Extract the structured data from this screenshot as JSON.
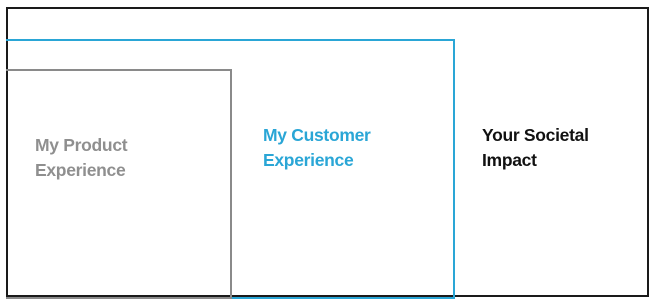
{
  "diagram": {
    "colors": {
      "outer": "#1a1a1a",
      "middle": "#2aa6d6",
      "inner": "#8a8a8a"
    },
    "layers": [
      {
        "id": "product",
        "line1": "My Product",
        "line2": "Experience",
        "color": "#8f8f8f"
      },
      {
        "id": "customer",
        "line1": "My Customer",
        "line2": "Experience",
        "color": "#2aa6d6"
      },
      {
        "id": "societal",
        "line1": "Your Societal",
        "line2": "Impact",
        "color": "#111111"
      }
    ]
  }
}
